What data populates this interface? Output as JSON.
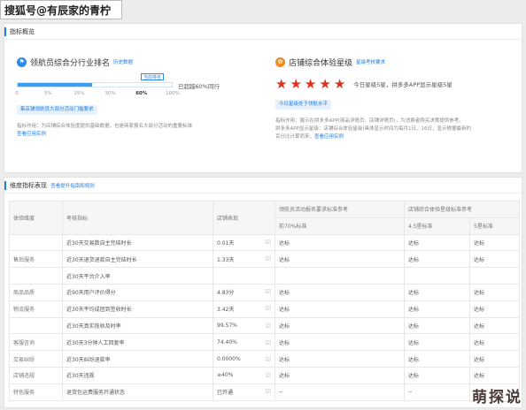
{
  "watermark_top": "搜狐号@有辰家的青柠",
  "watermark_bottom": "萌探说",
  "overview": {
    "section_title": "指标概览",
    "left": {
      "title": "领航员综合分行业排名",
      "sub_link": "历史数据",
      "bubble": "当前排名",
      "progress_percent": 60,
      "bar_text": "已超越60%同行",
      "ticks": [
        "0",
        "5%",
        "15%",
        "30%",
        "60%",
        "100%"
      ],
      "pill": "集店铺领航员大部分活动门槛要求",
      "desc": "指标作用：为店铺综合体验度提供基础数据，也是商家报名大部分活动的重要标准",
      "desc_link": "查看应用实例"
    },
    "right": {
      "title": "店铺综合体验星级",
      "sub_link": "星级考核要求",
      "stars": 5,
      "star_text": "今日星级5星，拼多多APP显示星级5星",
      "pill": "今日星级处于领航水平",
      "desc_lines": [
        "指标作用：展示在拼多多APP(商品详情页、店铺详情页)，为消费者购买决策提供参考。",
        "拼多多APP显示星级：店铺综合体验星级(具体显示时间为每月1日、16日，显示根据最新的",
        "百分比计算而来，"
      ],
      "desc_link": "查看应用实例"
    }
  },
  "dims": {
    "section_title": "维度指标表现",
    "section_link": "查看提升指南和规则",
    "headers": {
      "dimension": "体验维度",
      "metric": "考核指标",
      "perf": "店铺表现",
      "grp1": "领航员活动报名要求标准参考",
      "grp1_sub": "前70%标准",
      "grp2": "店铺综合体验星级标准参考",
      "grp2_sub1": "4.5星标准",
      "grp2_sub2": "5星标准"
    },
    "rows": [
      {
        "dim": "",
        "metric": "近30天交易数自主完结时长",
        "value": "0.01天",
        "r1": "达标",
        "r2": "达标",
        "r3": "达标"
      },
      {
        "dim": "售后服务",
        "metric": "近30天退货退款自主完结时长",
        "value": "1.33天",
        "r1": "达标",
        "r2": "达标",
        "r3": "达标"
      },
      {
        "dim": "",
        "metric": "近30天平台介入率",
        "value": "",
        "r1": "",
        "r2": "",
        "r3": ""
      },
      {
        "dim": "商品品质",
        "metric": "近90天用户评价得分",
        "value": "4.83分",
        "r1": "达标",
        "r2": "达标",
        "r3": "达标"
      },
      {
        "dim": "物流服务",
        "metric": "近30天平均成团到签收时长",
        "value": "3.42天",
        "r1": "达标",
        "r2": "达标",
        "r3": "达标"
      },
      {
        "dim": "",
        "metric": "近30天真实揽收及时率",
        "value": "99.57%",
        "r1": "达标",
        "r2": "达标",
        "r3": "达标"
      },
      {
        "dim": "客服咨询",
        "metric": "近30天3分钟人工回复率",
        "value": "74.40%",
        "r1": "达标",
        "r2": "达标",
        "r3": "达标"
      },
      {
        "dim": "交易纠纷",
        "metric": "近30天纠纷退款率",
        "value": "0.0000%",
        "r1": "达标",
        "r2": "达标",
        "r3": "达标"
      },
      {
        "dim": "店铺违规",
        "metric": "近30天违规",
        "value": "≥40%",
        "r1": "达标",
        "r2": "达标",
        "r3": "达标"
      },
      {
        "dim": "特色服务",
        "metric": "退货包运费服务开通状态",
        "value": "已开通",
        "r1": "--",
        "r2": "--",
        "r3": "--"
      }
    ]
  },
  "colors": {
    "accent": "#1f7fe0",
    "bar": "#3aa0f2",
    "star": "#e0301e",
    "warn_icon": "#f08a1f"
  }
}
